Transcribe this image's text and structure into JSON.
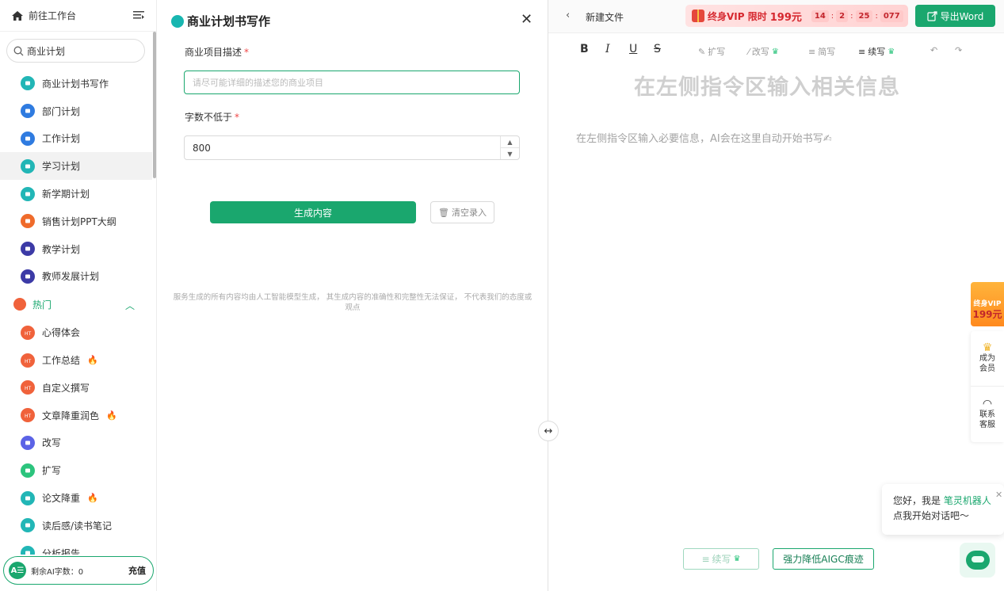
{
  "sidebar": {
    "home_label": "前往工作台",
    "search_value": "商业计划",
    "items": [
      {
        "label": "商业计划书写作",
        "color": "#22b6b6",
        "icon": "doc-icon"
      },
      {
        "label": "部门计划",
        "color": "#2f7be0",
        "icon": "briefcase-icon"
      },
      {
        "label": "工作计划",
        "color": "#2f7be0",
        "icon": "briefcase-icon"
      },
      {
        "label": "学习计划",
        "color": "#22b6b6",
        "icon": "card-icon"
      },
      {
        "label": "新学期计划",
        "color": "#22b6b6",
        "icon": "card-icon"
      },
      {
        "label": "销售计划PPT大纲",
        "color": "#ef6b2b",
        "icon": "ppt-icon"
      },
      {
        "label": "教学计划",
        "color": "#3c3aa6",
        "icon": "cap-icon"
      },
      {
        "label": "教师发展计划",
        "color": "#3c3aa6",
        "icon": "cap-icon"
      }
    ],
    "hot_group": "热门",
    "hot_items": [
      {
        "label": "心得体会",
        "color": "#f0623b",
        "icon": "hot-icon",
        "flame": false
      },
      {
        "label": "工作总结",
        "color": "#f0623b",
        "icon": "hot-icon",
        "flame": true
      },
      {
        "label": "自定义撰写",
        "color": "#f0623b",
        "icon": "hot-icon",
        "flame": false
      },
      {
        "label": "文章降重润色",
        "color": "#f0623b",
        "icon": "hot-icon",
        "flame": true
      },
      {
        "label": "改写",
        "color": "#5b63e6",
        "icon": "pen-icon",
        "flame": false
      },
      {
        "label": "扩写",
        "color": "#2cc47d",
        "icon": "pen-icon",
        "flame": false
      },
      {
        "label": "论文降重",
        "color": "#22b6b6",
        "icon": "card-icon",
        "flame": true
      },
      {
        "label": "读后感/读书笔记",
        "color": "#22b6b6",
        "icon": "card-icon",
        "flame": false
      },
      {
        "label": "分析报告",
        "color": "#22b6b6",
        "icon": "card-icon",
        "flame": false
      }
    ],
    "ai_badge": "A☰",
    "ai_remaining": "剩余AI字数：0",
    "recharge": "充值"
  },
  "form": {
    "title": "商业计划书写作",
    "desc_label": "商业项目描述",
    "desc_placeholder": "请尽可能详细的描述您的商业项目",
    "words_label": "字数不低于",
    "words_value": "800",
    "generate": "生成内容",
    "clear": "清空录入",
    "disclaimer": "服务生成的所有内容均由人工智能模型生成， 其生成内容的准确性和完整性无法保证， 不代表我们的态度或观点",
    "required_mark": "*"
  },
  "editor": {
    "back": "‹",
    "new_file": "新建文件",
    "vip_text": "终身VIP 限时",
    "vip_price": "199元",
    "countdown": [
      "14",
      "2",
      "25",
      "077"
    ],
    "export": "导出Word",
    "tools": {
      "bold": "B",
      "italic": "I",
      "underline": "U",
      "strike": "S",
      "expand": "扩写",
      "rewrite": "改写",
      "simplify": "简写",
      "continue": "续写"
    },
    "heading": "在左侧指令区输入相关信息",
    "hint": "在左侧指令区输入必要信息，AI会在这里自动开始书写✍",
    "continue_btn": "续写",
    "aigc_btn": "强力降低AIGC痕迹"
  },
  "float": {
    "vip_line": "终身VIP",
    "vip_price": "199元",
    "member": "成为\n会员",
    "service": "联系\n客服",
    "bubble_prefix": "您好，我是",
    "bubble_name": "笔灵机器人",
    "bubble_line2": "点我开始对话吧～"
  },
  "colors": {
    "accent": "#1aa76e",
    "vip_red": "#d6282f"
  }
}
